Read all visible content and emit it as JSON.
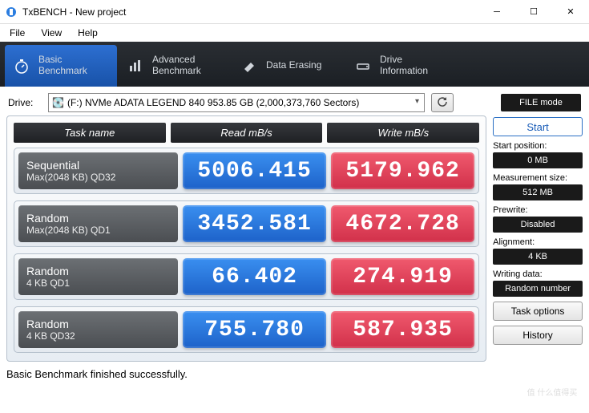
{
  "window": {
    "title": "TxBENCH - New project",
    "menu": {
      "file": "File",
      "view": "View",
      "help": "Help"
    }
  },
  "tabs": {
    "basic": {
      "l1": "Basic",
      "l2": "Benchmark"
    },
    "advanced": {
      "l1": "Advanced",
      "l2": "Benchmark"
    },
    "erasing": {
      "l1": "Data Erasing",
      "l2": ""
    },
    "drive": {
      "l1": "Drive",
      "l2": "Information"
    }
  },
  "drive": {
    "label": "Drive:",
    "selected": "(F:) NVMe ADATA LEGEND 840  953.85 GB (2,000,373,760 Sectors)",
    "file_mode": "FILE mode"
  },
  "headers": {
    "task": "Task name",
    "read": "Read mB/s",
    "write": "Write mB/s"
  },
  "rows": [
    {
      "t1": "Sequential",
      "t2": "Max(2048 KB) QD32",
      "read": "5006.415",
      "write": "5179.962"
    },
    {
      "t1": "Random",
      "t2": "Max(2048 KB) QD1",
      "read": "3452.581",
      "write": "4672.728"
    },
    {
      "t1": "Random",
      "t2": "4 KB QD1",
      "read": "66.402",
      "write": "274.919"
    },
    {
      "t1": "Random",
      "t2": "4 KB QD32",
      "read": "755.780",
      "write": "587.935"
    }
  ],
  "side": {
    "start": "Start",
    "start_pos": {
      "label": "Start position:",
      "value": "0 MB"
    },
    "meas_size": {
      "label": "Measurement size:",
      "value": "512 MB"
    },
    "prewrite": {
      "label": "Prewrite:",
      "value": "Disabled"
    },
    "alignment": {
      "label": "Alignment:",
      "value": "4 KB"
    },
    "writing": {
      "label": "Writing data:",
      "value": "Random number"
    },
    "task_options": "Task options",
    "history": "History"
  },
  "status": "Basic Benchmark finished successfully.",
  "watermark": "值 什么值得买",
  "chart_data": {
    "type": "table",
    "title": "TxBENCH Basic Benchmark",
    "columns": [
      "Task name",
      "Read mB/s",
      "Write mB/s"
    ],
    "rows": [
      [
        "Sequential Max(2048 KB) QD32",
        5006.415,
        5179.962
      ],
      [
        "Random Max(2048 KB) QD1",
        3452.581,
        4672.728
      ],
      [
        "Random 4 KB QD1",
        66.402,
        274.919
      ],
      [
        "Random 4 KB QD32",
        755.78,
        587.935
      ]
    ]
  }
}
